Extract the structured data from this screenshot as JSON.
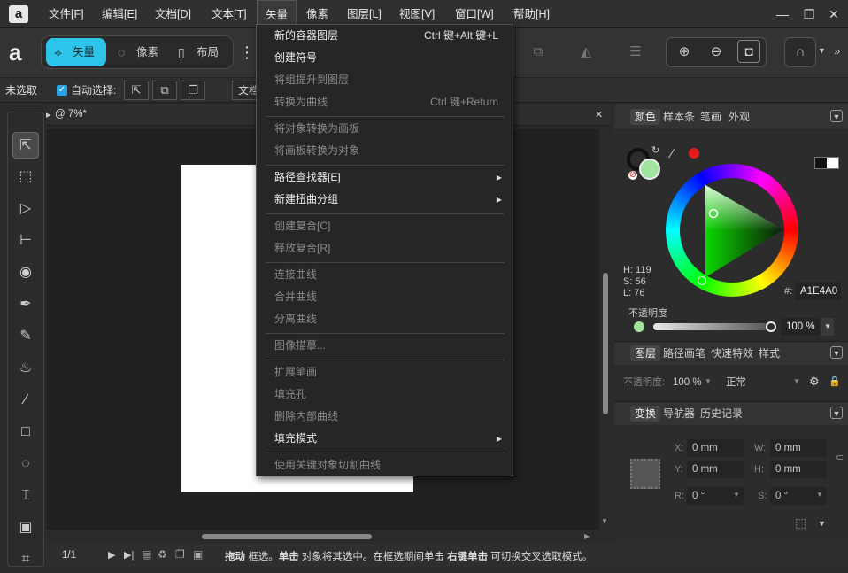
{
  "menubar": {
    "logo": "a",
    "items": [
      "文件[F]",
      "编辑[E]",
      "文档[D]",
      "文本[T]",
      "矢量",
      "像素",
      "图层[L]",
      "视图[V]",
      "窗口[W]",
      "帮助[H]"
    ],
    "window_controls": {
      "minimize": "—",
      "restore": "❐",
      "close": "✕"
    }
  },
  "toolbar": {
    "personas": [
      {
        "label": "矢量",
        "icon": "vector-persona-icon"
      },
      {
        "label": "像素",
        "icon": "pixel-persona-icon"
      },
      {
        "label": "布局",
        "icon": "layout-persona-icon"
      }
    ],
    "more": "⋮"
  },
  "contextbar": {
    "selection": "未选取",
    "auto_select_label": "自动选择:",
    "auto_select_checked": true,
    "doc_button": "文档"
  },
  "document": {
    "tab_title": "@ 7%*",
    "close": "✕",
    "page_indicator": "1/1",
    "status_parts": [
      {
        "text": "拖动",
        "bold": true
      },
      {
        "text": " 框选。",
        "bold": false
      },
      {
        "text": "单击",
        "bold": true
      },
      {
        "text": " 对象将其选中。在框选期间单击 ",
        "bold": false
      },
      {
        "text": "右键单击",
        "bold": true
      },
      {
        "text": " 可切换交叉选取模式。",
        "bold": false
      }
    ]
  },
  "vector_menu": {
    "items": [
      {
        "label": "新的容器图层",
        "shortcut": "Ctrl 键+Alt 键+L",
        "enabled": true
      },
      {
        "label": "创建符号",
        "enabled": true
      },
      {
        "label": "将组提升到图层",
        "enabled": false
      },
      {
        "label": "转换为曲线",
        "shortcut": "Ctrl 键+Return",
        "enabled": false
      },
      {
        "separator": true
      },
      {
        "label": "将对象转换为画板",
        "enabled": false
      },
      {
        "label": "将画板转换为对象",
        "enabled": false
      },
      {
        "separator": true
      },
      {
        "label": "路径查找器[E]",
        "enabled": true,
        "submenu": true
      },
      {
        "label": "新建扭曲分组",
        "enabled": true,
        "submenu": true
      },
      {
        "separator": true
      },
      {
        "label": "创建复合[C]",
        "enabled": false
      },
      {
        "label": "释放复合[R]",
        "enabled": false
      },
      {
        "separator": true
      },
      {
        "label": "连接曲线",
        "enabled": false
      },
      {
        "label": "合并曲线",
        "enabled": false
      },
      {
        "label": "分离曲线",
        "enabled": false
      },
      {
        "separator": true
      },
      {
        "label": "图像描摹...",
        "enabled": false
      },
      {
        "separator": true
      },
      {
        "label": "扩展笔画",
        "enabled": false
      },
      {
        "label": "填充孔",
        "enabled": false
      },
      {
        "label": "删除内部曲线",
        "enabled": false
      },
      {
        "label": "填充模式",
        "enabled": true,
        "submenu": true
      },
      {
        "separator": true
      },
      {
        "label": "使用关键对象切割曲线",
        "enabled": false
      }
    ]
  },
  "color_panel": {
    "tabs": [
      "颜色",
      "样本条",
      "笔画",
      "外观"
    ],
    "hsl": {
      "h": "H: 119",
      "s": "S: 56",
      "l": "L: 76"
    },
    "hex_label": "#:",
    "hex": "A1E4A0",
    "fill_color": "#a1e4a0",
    "accent_color": "#e21a1a",
    "opacity_label": "不透明度",
    "opacity_value": "100 %"
  },
  "layers_panel": {
    "tabs": [
      "图层",
      "路径画笔",
      "快速特效",
      "样式"
    ],
    "opacity_label": "不透明度:",
    "opacity_value": "100 %",
    "blend_mode": "正常"
  },
  "transform_panel": {
    "tabs": [
      "变换",
      "导航器",
      "历史记录"
    ],
    "fields": [
      {
        "label": "X:",
        "value": "0 mm"
      },
      {
        "label": "W:",
        "value": "0 mm"
      },
      {
        "label": "Y:",
        "value": "0 mm"
      },
      {
        "label": "H:",
        "value": "0 mm"
      },
      {
        "label": "R:",
        "value": "0 °"
      },
      {
        "label": "S:",
        "value": "0 °"
      }
    ]
  }
}
